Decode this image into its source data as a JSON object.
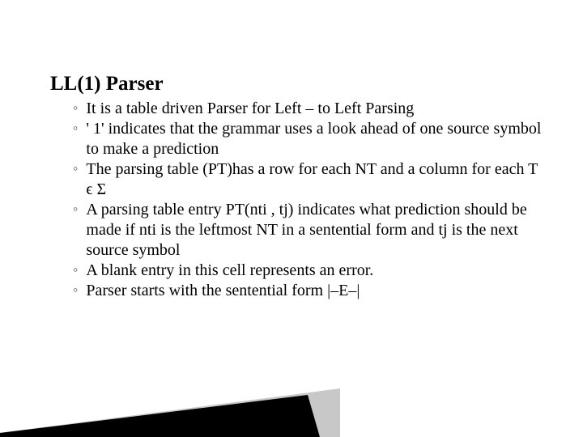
{
  "slide": {
    "title": "LL(1) Parser",
    "bullets": [
      "It is a table driven Parser for Left – to Left Parsing",
      " ' 1' indicates that the grammar uses a look ahead of one source symbol to make a prediction",
      "The parsing table (PT)has a row for each NT and a column for each T ϵ Σ",
      "A parsing table entry PT(nti , tj) indicates what prediction should be made if nti is the leftmost NT in a sentential form and tj is the next source symbol",
      "A blank entry in this cell represents an error.",
      "Parser starts with the sentential form |–E–|"
    ],
    "title_bullet_glyph": "",
    "sub_bullet_glyph": "◦"
  }
}
